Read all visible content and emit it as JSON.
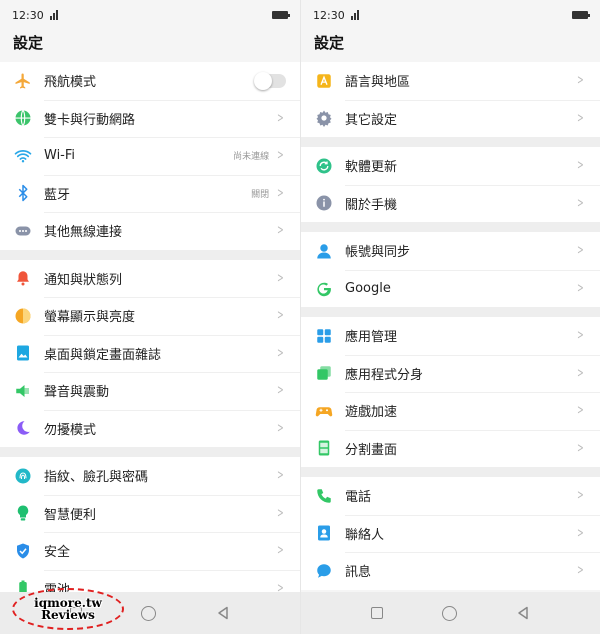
{
  "left": {
    "status": {
      "time": "12:30"
    },
    "title": "設定",
    "groups": [
      {
        "items": [
          {
            "icon": "airplane-icon",
            "label": "飛航模式",
            "toggle": "off"
          },
          {
            "icon": "globe-icon",
            "label": "雙卡與行動網路"
          },
          {
            "icon": "wifi-icon",
            "label": "Wi-Fi",
            "value": "尚未連線"
          },
          {
            "icon": "bluetooth-icon",
            "label": "藍牙",
            "value": "關閉"
          },
          {
            "icon": "more-icon",
            "label": "其他無線連接"
          }
        ]
      },
      {
        "items": [
          {
            "icon": "bell-icon",
            "label": "通知與狀態列"
          },
          {
            "icon": "brightness-icon",
            "label": "螢幕顯示與亮度"
          },
          {
            "icon": "wallpaper-icon",
            "label": "桌面與鎖定畫面雜誌"
          },
          {
            "icon": "speaker-icon",
            "label": "聲音與震動"
          },
          {
            "icon": "moon-icon",
            "label": "勿擾模式"
          }
        ]
      },
      {
        "items": [
          {
            "icon": "fingerprint-icon",
            "label": "指紋、臉孔與密碼"
          },
          {
            "icon": "lightbulb-icon",
            "label": "智慧便利"
          },
          {
            "icon": "shield-icon",
            "label": "安全"
          },
          {
            "icon": "battery-icon",
            "label": "電池"
          }
        ]
      }
    ],
    "watermark": {
      "line1": "iqmore.tw",
      "line2": "Reviews"
    }
  },
  "right": {
    "status": {
      "time": "12:30"
    },
    "title": "設定",
    "groups": [
      {
        "items": [
          {
            "icon": "language-icon",
            "label": "語言與地區"
          },
          {
            "icon": "gear-icon",
            "label": "其它設定"
          }
        ]
      },
      {
        "items": [
          {
            "icon": "refresh-icon",
            "label": "軟體更新"
          },
          {
            "icon": "info-icon",
            "label": "關於手機"
          }
        ]
      },
      {
        "items": [
          {
            "icon": "person-icon",
            "label": "帳號與同步"
          },
          {
            "icon": "google-icon",
            "label": "Google"
          }
        ]
      },
      {
        "items": [
          {
            "icon": "grid-icon",
            "label": "應用管理"
          },
          {
            "icon": "app-clone-icon",
            "label": "應用程式分身"
          },
          {
            "icon": "gamepad-icon",
            "label": "遊戲加速"
          },
          {
            "icon": "split-screen-icon",
            "label": "分割畫面"
          }
        ]
      },
      {
        "items": [
          {
            "icon": "phone-icon",
            "label": "電話"
          },
          {
            "icon": "contacts-icon",
            "label": "聯絡人"
          },
          {
            "icon": "message-icon",
            "label": "訊息"
          }
        ]
      }
    ]
  }
}
